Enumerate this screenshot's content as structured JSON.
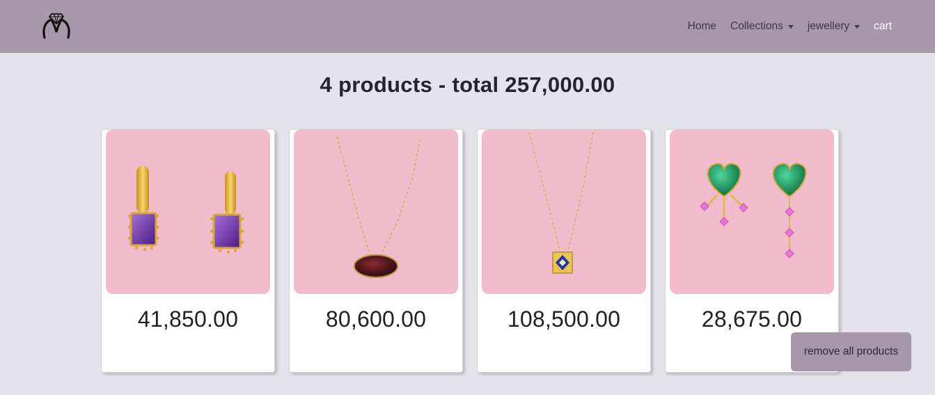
{
  "nav": {
    "links": [
      {
        "label": "Home"
      },
      {
        "label": "Collections",
        "dropdown": true
      },
      {
        "label": "jewellery",
        "dropdown": true
      },
      {
        "label": "cart",
        "active": true
      }
    ],
    "logo_icon": "ring-logo-icon"
  },
  "summary": "4 products - total 257,000.00",
  "products": [
    {
      "price": "41,850.00",
      "image": "amethyst-earrings-image"
    },
    {
      "price": "80,600.00",
      "image": "oval-pendant-necklace-image"
    },
    {
      "price": "108,500.00",
      "image": "square-pendant-necklace-image"
    },
    {
      "price": "28,675.00",
      "image": "emerald-heart-earrings-image"
    }
  ],
  "remove_all_label": "remove all products",
  "colors": {
    "navbar": "#a599a9",
    "page_background": "#e4e3e9",
    "image_background": "#f0bccb",
    "button": "#a599a9"
  }
}
